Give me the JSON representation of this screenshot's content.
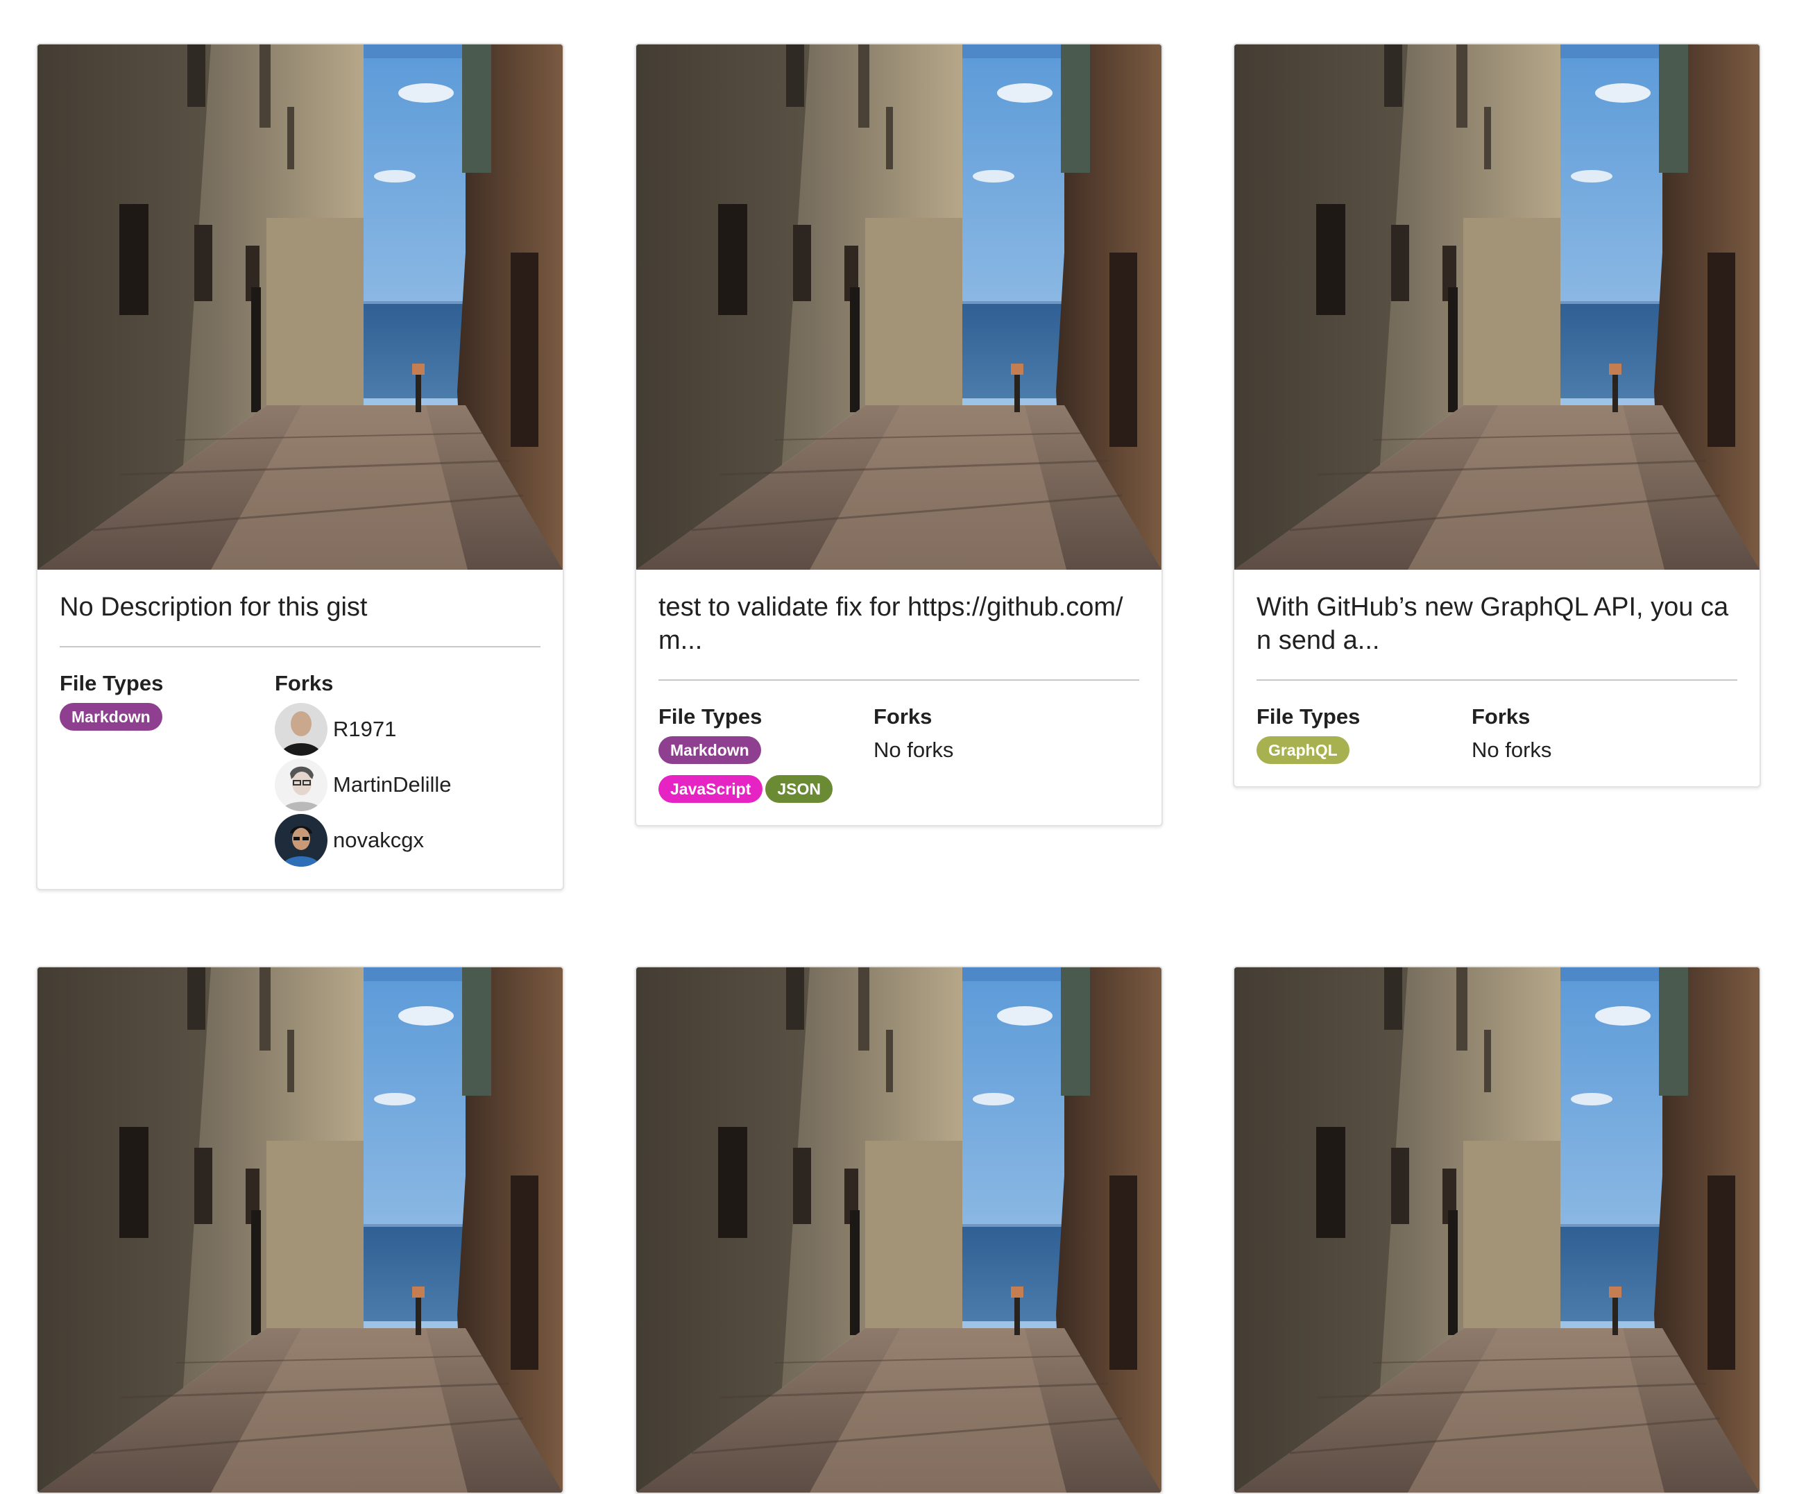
{
  "cards": [
    {
      "title": "No Description for this gist",
      "file_types_label": "File Types",
      "forks_label": "Forks",
      "tags": [
        {
          "label": "Markdown",
          "color": "#8e3f8f"
        }
      ],
      "forks": [
        {
          "name": "R1971",
          "avatar": "avatar-photo-1"
        },
        {
          "name": "MartinDelille",
          "avatar": "avatar-photo-2"
        },
        {
          "name": "novakcgx",
          "avatar": "avatar-photo-3"
        }
      ],
      "no_forks_text": ""
    },
    {
      "title": "test to validate fix for https://github.com/m...",
      "file_types_label": "File Types",
      "forks_label": "Forks",
      "tags": [
        {
          "label": "Markdown",
          "color": "#8e3f8f"
        },
        {
          "label": "JavaScript",
          "color": "#e624c4"
        },
        {
          "label": "JSON",
          "color": "#6a8a33"
        }
      ],
      "forks": [],
      "no_forks_text": "No forks"
    },
    {
      "title": "With GitHub’s new GraphQL API, you can send a...",
      "file_types_label": "File Types",
      "forks_label": "Forks",
      "tags": [
        {
          "label": "GraphQL",
          "color": "#a8b14f"
        }
      ],
      "forks": [],
      "no_forks_text": "No forks"
    }
  ],
  "image_icon": "alley-sea-photo",
  "colors": {
    "divider": "#c8c8c8",
    "card_border": "#e3e3e3"
  }
}
